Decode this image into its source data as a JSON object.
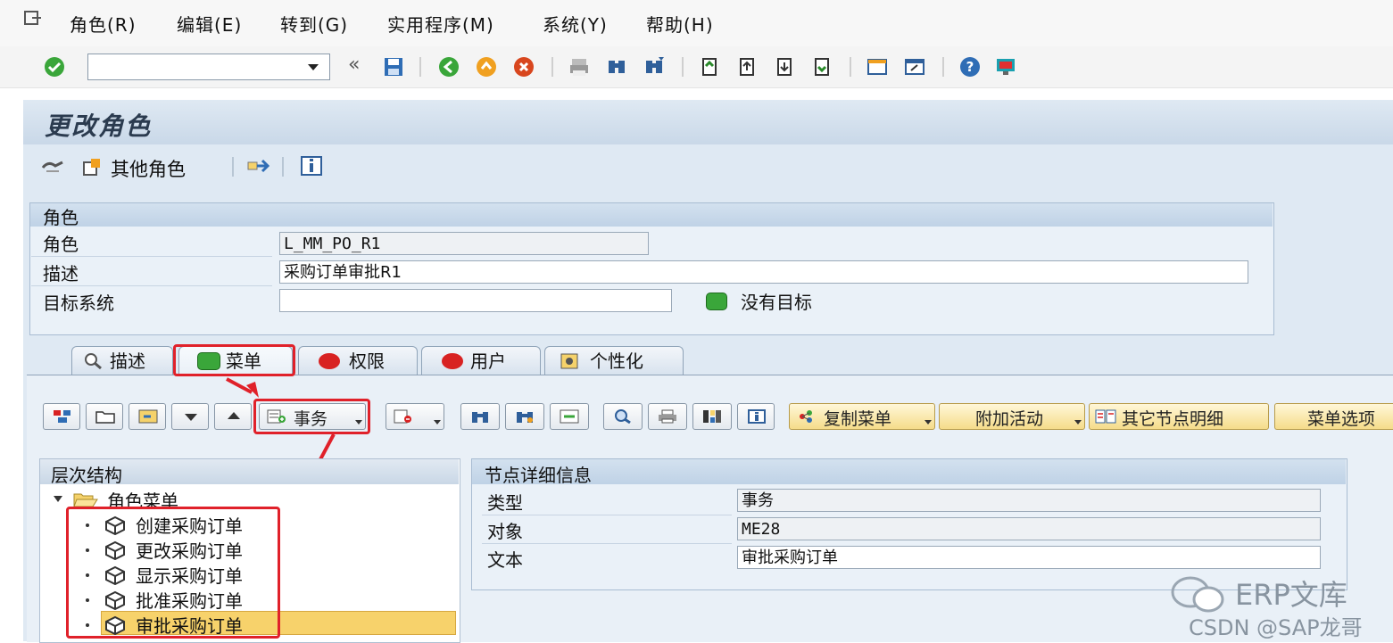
{
  "menubar": {
    "items": [
      "角色(R)",
      "编辑(E)",
      "转到(G)",
      "实用程序(M)",
      "系统(Y)",
      "帮助(H)"
    ]
  },
  "stdbar": {
    "command_field_value": "",
    "back_glyph": "«"
  },
  "page": {
    "title": "更改角色"
  },
  "apptoolbar": {
    "other_role_label": "其他角色"
  },
  "role_group": {
    "title": "角色",
    "fields": [
      {
        "label": "角色",
        "value": "L_MM_PO_R1"
      },
      {
        "label": "描述",
        "value": "采购订单审批R1"
      },
      {
        "label": "目标系统",
        "value": ""
      }
    ],
    "status_text": "没有目标"
  },
  "tabs": [
    "描述",
    "菜单",
    "权限",
    "用户",
    "个性化"
  ],
  "menu_toolbar": {
    "transaction_label": "事务",
    "copy_menu_label": "复制菜单",
    "add_activity_label": "附加活动",
    "other_node_label": "其它节点明细",
    "menu_options_label": "菜单选项"
  },
  "hierarchy": {
    "title": "层次结构",
    "root": "角色菜单",
    "items": [
      "创建采购订单",
      "更改采购订单",
      "显示采购订单",
      "批准采购订单",
      "审批采购订单"
    ]
  },
  "node_detail": {
    "title": "节点详细信息",
    "rows": [
      {
        "label": "类型",
        "value": "事务"
      },
      {
        "label": "对象",
        "value": "ME28"
      },
      {
        "label": "文本",
        "value": "审批采购订单"
      }
    ]
  },
  "watermark": {
    "line1": "ERP文库",
    "line2": "CSDN @SAP龙哥"
  },
  "colors": {
    "highlight_red": "#e0212a",
    "status_green": "#3aa63a",
    "status_red": "#d82222",
    "selected_row": "#f7d26b"
  }
}
